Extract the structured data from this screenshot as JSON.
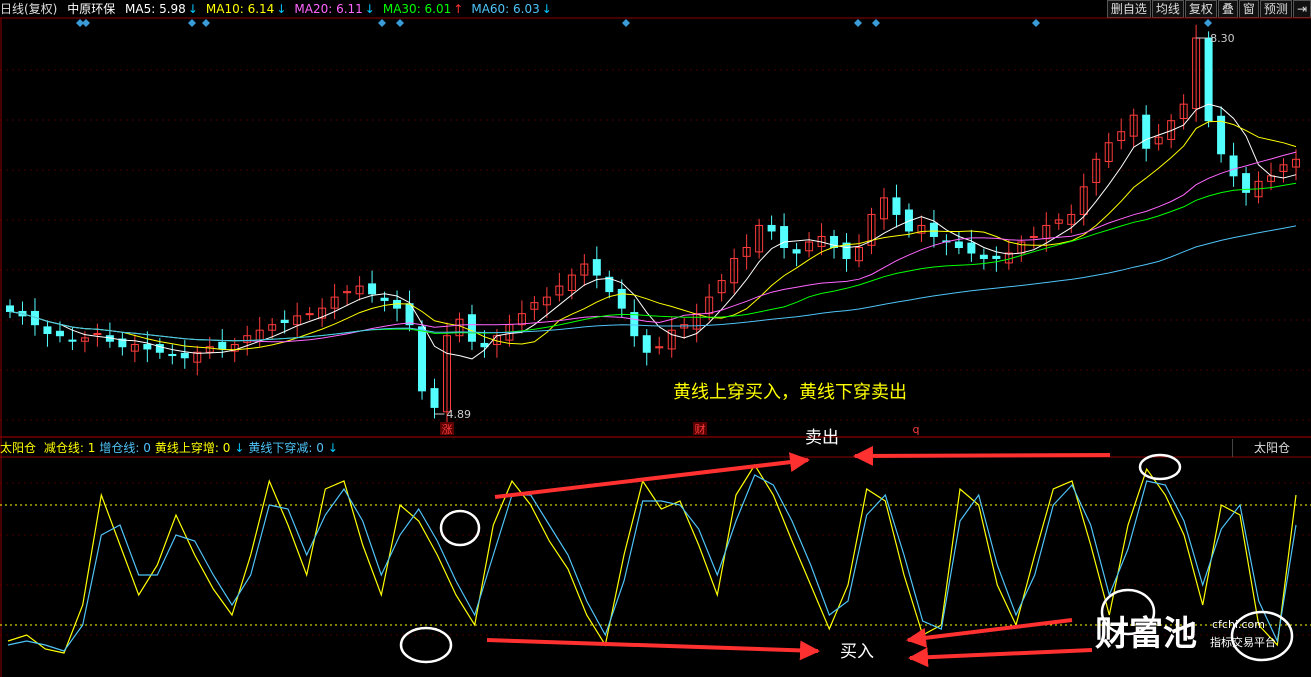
{
  "header": {
    "period": "日线(复权)",
    "stock_name": "中原环保",
    "ma": [
      {
        "label": "MA5: 5.98",
        "arrow": "↓",
        "color": "#ffffff",
        "arrow_color": "#00c8ff"
      },
      {
        "label": "MA10: 6.14",
        "arrow": "↓",
        "color": "#ffff00",
        "arrow_color": "#00c8ff"
      },
      {
        "label": "MA20: 6.11",
        "arrow": "↓",
        "color": "#ff66ff",
        "arrow_color": "#00c8ff"
      },
      {
        "label": "MA30: 6.01",
        "arrow": "↑",
        "color": "#00ff00",
        "arrow_color": "#ff3333"
      },
      {
        "label": "MA60: 6.03",
        "arrow": "↓",
        "color": "#4fc3f7",
        "arrow_color": "#00c8ff"
      }
    ]
  },
  "toolbar": {
    "buttons": [
      "删自选",
      "均线",
      "复权",
      "叠",
      "窗",
      "预测",
      "⇥"
    ]
  },
  "main_chart": {
    "high_label": "8.30",
    "low_label": "4.89",
    "annotation": "黄线上穿买入，黄线下穿卖出",
    "event_markers": [
      "涨",
      "财",
      "q"
    ],
    "colors": {
      "up": "#ff3c3c",
      "down": "#54ffff",
      "bg": "#000000",
      "grid": "#8b0000"
    }
  },
  "indicator": {
    "name": "太阳仓",
    "items": [
      {
        "label": "减仓线: 1",
        "color": "#ffff00"
      },
      {
        "label": "增仓线: 0",
        "color": "#4fc3f7"
      },
      {
        "label": "黄线上穿增: 0",
        "color": "#ffff00",
        "arrow": "↓"
      },
      {
        "label": "黄线下穿减: 0",
        "color": "#4fc3f7",
        "arrow": "↓"
      }
    ],
    "name_button": "太阳仓",
    "sell_label": "卖出",
    "buy_label": "买入"
  },
  "watermark": {
    "brand": "财富池",
    "domain": "cfchi.com",
    "tagline": "指标交易平台"
  },
  "chart_data": [
    {
      "type": "candlestick",
      "title": "中原环保 日线(复权)",
      "ylim": [
        4.89,
        8.3
      ],
      "notes": "approximate daily closes read from chart, left to right",
      "close": [
        5.82,
        5.78,
        5.7,
        5.62,
        5.6,
        5.55,
        5.58,
        5.62,
        5.55,
        5.5,
        5.52,
        5.48,
        5.45,
        5.42,
        5.4,
        5.45,
        5.5,
        5.48,
        5.52,
        5.6,
        5.65,
        5.7,
        5.72,
        5.78,
        5.8,
        5.85,
        5.95,
        6.0,
        6.05,
        5.98,
        5.92,
        5.85,
        5.7,
        5.1,
        4.95,
        5.6,
        5.75,
        5.55,
        5.5,
        5.6,
        5.7,
        5.8,
        5.9,
        5.95,
        6.05,
        6.15,
        6.25,
        6.15,
        6.0,
        5.85,
        5.6,
        5.45,
        5.5,
        5.65,
        5.7,
        5.8,
        5.95,
        6.1,
        6.3,
        6.4,
        6.6,
        6.55,
        6.4,
        6.35,
        6.45,
        6.5,
        6.4,
        6.3,
        6.4,
        6.7,
        6.85,
        6.7,
        6.55,
        6.6,
        6.5,
        6.45,
        6.4,
        6.35,
        6.3,
        6.3,
        6.35,
        6.45,
        6.5,
        6.6,
        6.65,
        6.7,
        6.95,
        7.2,
        7.35,
        7.45,
        7.6,
        7.3,
        7.4,
        7.55,
        7.7,
        8.3,
        7.55,
        7.25,
        7.05,
        6.9,
        7.0,
        7.05,
        7.15,
        7.2
      ]
    },
    {
      "type": "line",
      "title": "太阳仓",
      "series": [
        {
          "name": "减仓线",
          "color": "#ffff00",
          "values": [
            0.12,
            0.15,
            0.08,
            0.06,
            0.3,
            0.85,
            0.6,
            0.35,
            0.5,
            0.75,
            0.55,
            0.38,
            0.25,
            0.55,
            0.92,
            0.7,
            0.45,
            0.88,
            0.92,
            0.6,
            0.35,
            0.8,
            0.72,
            0.55,
            0.35,
            0.2,
            0.7,
            0.92,
            0.8,
            0.62,
            0.48,
            0.25,
            0.1,
            0.55,
            0.92,
            0.78,
            0.82,
            0.6,
            0.35,
            0.85,
            1.0,
            0.85,
            0.62,
            0.4,
            0.18,
            0.4,
            0.88,
            0.82,
            0.45,
            0.15,
            0.2,
            0.88,
            0.8,
            0.4,
            0.2,
            0.55,
            0.88,
            0.92,
            0.6,
            0.25,
            0.7,
            0.98,
            0.85,
            0.65,
            0.3,
            0.8,
            0.75,
            0.2,
            0.1,
            0.85
          ]
        },
        {
          "name": "增仓线",
          "color": "#4fc3f7",
          "values": [
            0.1,
            0.12,
            0.1,
            0.07,
            0.2,
            0.65,
            0.7,
            0.45,
            0.45,
            0.65,
            0.62,
            0.45,
            0.3,
            0.45,
            0.8,
            0.78,
            0.55,
            0.75,
            0.88,
            0.72,
            0.45,
            0.65,
            0.78,
            0.62,
            0.42,
            0.25,
            0.55,
            0.85,
            0.85,
            0.7,
            0.55,
            0.32,
            0.15,
            0.42,
            0.82,
            0.82,
            0.8,
            0.68,
            0.45,
            0.72,
            0.95,
            0.9,
            0.72,
            0.5,
            0.25,
            0.32,
            0.75,
            0.85,
            0.55,
            0.22,
            0.18,
            0.72,
            0.85,
            0.5,
            0.25,
            0.45,
            0.8,
            0.9,
            0.7,
            0.35,
            0.58,
            0.92,
            0.9,
            0.72,
            0.4,
            0.68,
            0.8,
            0.32,
            0.12,
            0.7
          ]
        }
      ],
      "levels": [
        0.2,
        0.8
      ]
    }
  ]
}
